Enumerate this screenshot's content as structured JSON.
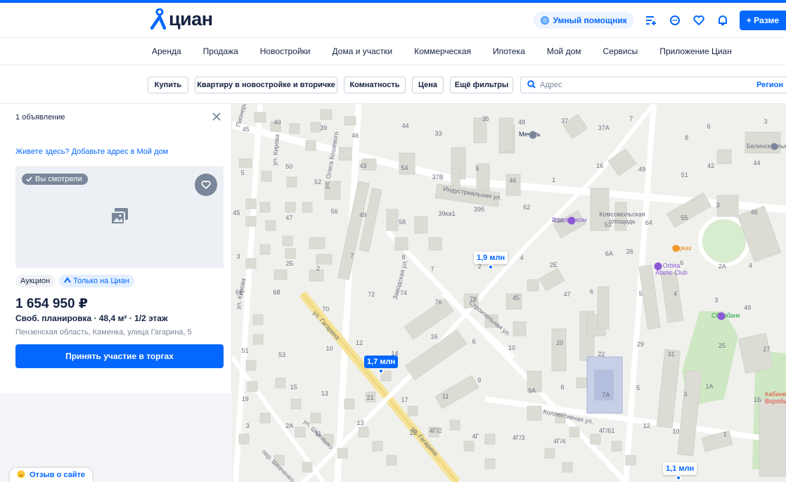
{
  "header": {
    "logo_text": "циан",
    "assistant_label": "Умный помощник",
    "place_ad_label": "+ Разме"
  },
  "nav": {
    "items": [
      "Аренда",
      "Продажа",
      "Новостройки",
      "Дома и участки",
      "Коммерческая",
      "Ипотека",
      "Мой дом",
      "Сервисы",
      "Приложение Циан"
    ]
  },
  "filters": {
    "deal": "Купить",
    "type": "Квартиру в новостройке и вторичке",
    "rooms": "Комнатность",
    "price": "Цена",
    "more": "Ещё фильтры",
    "address_placeholder": "Адрес",
    "region": "Регион"
  },
  "sidebar": {
    "count": "1 объявление",
    "mydom_link": "Живете здесь? Добавьте адрес в Мой дом",
    "seen_badge": "Вы смотрели",
    "tag_auction": "Аукцион",
    "tag_only": "Только на Циан",
    "price": "1 654 950 ₽",
    "params": "Своб. планировка · 48,4 м² · 1/2 этаж",
    "address": "Пензенская область, Каменка, улица Гагарина, 5",
    "cta": "Принять участие в торгах",
    "feedback": "Отзыв о сайте"
  },
  "map": {
    "pins": [
      "1,9 млн",
      "1,7 млн",
      "1,1 млн"
    ],
    "streets": [
      "Индустриальная ул.",
      "Строительная ул.",
      "Заводская ул.",
      "ул. Гагарина",
      "ул. Гагарина",
      "ул. Кирова",
      "ул. Олега Кошевого",
      "Коллективная ул.",
      "ул. Шевченко",
      "пер. Шевченко",
      "ул. Кирова",
      "Пионерс"
    ],
    "pois": [
      "Мечеть",
      "Ростелеком",
      "Комсомольская площадь",
      "Оджах",
      "Orbita Atletic Club",
      "Сбербанк",
      "Белинсксельм"
    ],
    "house_numbers": [
      "45",
      "40",
      "39",
      "46",
      "44",
      "33",
      "35",
      "48",
      "37",
      "37А",
      "7",
      "8",
      "6",
      "3",
      "5",
      "50",
      "52",
      "43",
      "54",
      "37В",
      "5",
      "46",
      "1",
      "16",
      "49",
      "51",
      "42",
      "44",
      "45",
      "47",
      "56",
      "49",
      "58",
      "39ка1",
      "39б",
      "62",
      "43А",
      "53",
      "64",
      "55",
      "3",
      "46",
      "3",
      "2Б",
      "2",
      "7",
      "8",
      "7",
      "2",
      "4",
      "2Е",
      "6А",
      "26",
      "6",
      "2А",
      "4",
      "66",
      "68",
      "70",
      "72",
      "74",
      "76",
      "78",
      "45",
      "47",
      "6",
      "5",
      "4",
      "3",
      "49",
      "51",
      "53",
      "10",
      "12",
      "14",
      "16",
      "6",
      "10",
      "20",
      "22",
      "29",
      "31",
      "25",
      "27",
      "19",
      "15",
      "13",
      "21",
      "17",
      "11",
      "9",
      "9А",
      "6",
      "7А",
      "5",
      "3",
      "1А",
      "1Б",
      "3",
      "2А",
      "11",
      "13",
      "2Е",
      "4Г/2",
      "4Г",
      "4Г/3",
      "4Г/4",
      "4Г/61",
      "12",
      "10",
      "1"
    ],
    "hospital_label": "Кабинет Воробьева"
  }
}
